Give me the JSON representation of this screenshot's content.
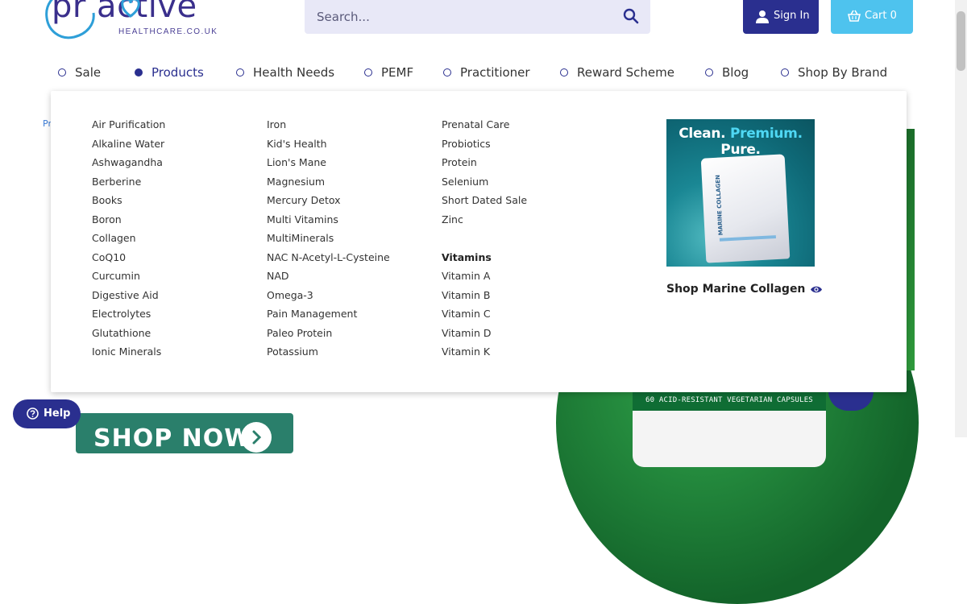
{
  "header": {
    "logo_word": "pr   active",
    "logo_sub": "HEALTHCARE.CO.UK",
    "search_placeholder": "Search...",
    "signin_label": "Sign In",
    "cart_label": "Cart 0"
  },
  "nav": {
    "items": [
      {
        "label": "Sale",
        "active": false
      },
      {
        "label": "Products",
        "active": true
      },
      {
        "label": "Health Needs",
        "active": false
      },
      {
        "label": "PEMF",
        "active": false
      },
      {
        "label": "Practitioner",
        "active": false
      },
      {
        "label": "Reward Scheme",
        "active": false
      },
      {
        "label": "Blog",
        "active": false
      },
      {
        "label": "Shop By Brand",
        "active": false
      }
    ]
  },
  "mega_menu": {
    "column1": [
      "Air Purification",
      "Alkaline Water",
      "Ashwagandha",
      "Berberine",
      "Books",
      "Boron",
      "Collagen",
      "CoQ10",
      "Curcumin",
      "Digestive Aid",
      "Electrolytes",
      "Glutathione",
      "Ionic Minerals"
    ],
    "column2": [
      "Iron",
      "Kid's Health",
      "Lion's Mane",
      "Magnesium",
      "Mercury Detox",
      "Multi Vitamins",
      "MultiMinerals",
      "NAC N-Acetyl-L-Cysteine",
      "NAD",
      "Omega-3",
      "Pain Management",
      "Paleo Protein",
      "Potassium"
    ],
    "column3": [
      "Prenatal Care",
      "Probiotics",
      "Protein",
      "Selenium",
      "Short Dated Sale",
      "Zinc"
    ],
    "vitamins_heading": "Vitamins",
    "vitamins": [
      "Vitamin A",
      "Vitamin B",
      "Vitamin C",
      "Vitamin D",
      "Vitamin K"
    ],
    "promo": {
      "headline_1": "Clean.",
      "headline_2": "Premium.",
      "headline_3": "Pure.",
      "pouch_text": "MARINE COLLAGEN",
      "link_label": "Shop Marine Collagen"
    }
  },
  "background": {
    "breadcrumb": "Pr",
    "jar_label": "60 ACID-RESISTANT VEGETARIAN CAPSULES",
    "shop_now_label": "SHOP NOW",
    "help_label": "Help"
  },
  "colors": {
    "brand_navy": "#2a2f8f",
    "cart_blue": "#4ec3ee",
    "search_bg": "#e8e8f7",
    "accent_cyan": "#4fd8f4"
  },
  "icons": [
    "search-icon",
    "user-icon",
    "basket-icon",
    "eye-icon",
    "help-icon",
    "chevron-right-icon"
  ]
}
